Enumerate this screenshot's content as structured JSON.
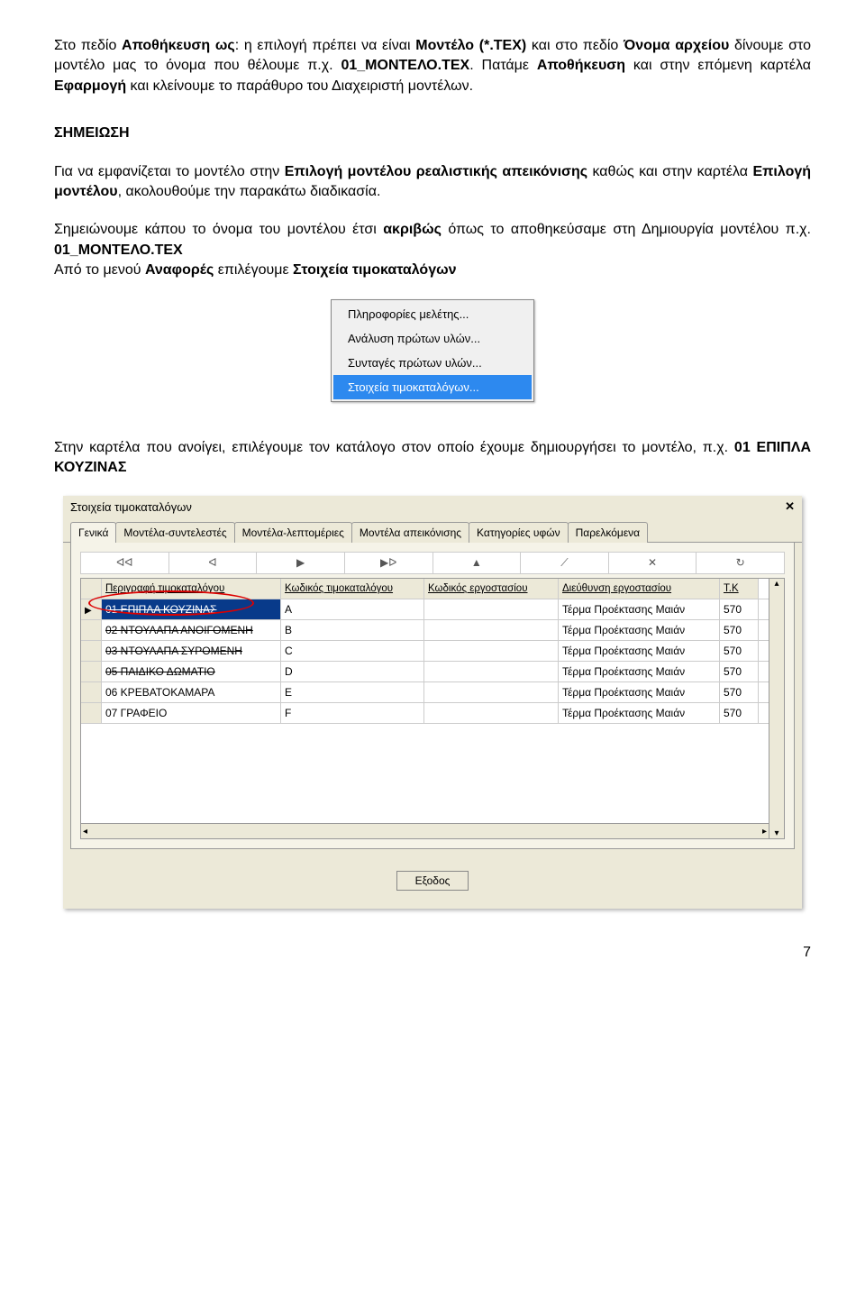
{
  "para1": {
    "t1": "Στο πεδίο ",
    "b1": "Αποθήκευση ως",
    "t2": ": η επιλογή πρέπει να είναι ",
    "b2": "Μοντέλο (*.TEX)",
    "t3": " και στο πεδίο ",
    "b3": "Όνομα αρχείου",
    "t4": " δίνουμε στο μοντέλο μας το όνομα που θέλουμε π.χ. ",
    "b4": "01_ΜΟΝΤΕΛΟ.TEX",
    "t5": ". Πατάμε ",
    "b5": "Αποθήκευση",
    "t6": " και στην επόμενη καρτέλα ",
    "b6": "Εφαρμογή",
    "t7": " και κλείνουμε το παράθυρο του Διαχειριστή μοντέλων."
  },
  "note": {
    "heading": "ΣΗΜΕΙΩΣΗ",
    "t1": "Για να εμφανίζεται το μοντέλο στην ",
    "b1": "Επιλογή μοντέλου ρεαλιστικής απεικόνισης",
    "t2": " καθώς και στην καρτέλα ",
    "b2": "Επιλογή μοντέλου",
    "t3": ", ακολουθούμε την παρακάτω διαδικασία.",
    "t4": "Σημειώνουμε κάπου το όνομα του μοντέλου έτσι ",
    "b3": "ακριβώς",
    "t5": " όπως το αποθηκεύσαμε στη Δημιουργία μοντέλου π.χ. ",
    "b4": "01_ΜΟΝΤΕΛΟ.TEX",
    "t6": "Από το μενού ",
    "b5": "Αναφορές",
    "t7": " επιλέγουμε ",
    "b6": "Στοιχεία τιμοκαταλόγων"
  },
  "menu": {
    "items": [
      "Πληροφορίες μελέτης...",
      "Ανάλυση πρώτων υλών...",
      "Συνταγές πρώτων υλών...",
      "Στοιχεία τιμοκαταλόγων..."
    ]
  },
  "para2": {
    "t1": "Στην καρτέλα που ανοίγει, επιλέγουμε τον κατάλογο στον οποίο έχουμε δημιουργήσει το μοντέλο, π.χ. ",
    "b1": "01 ΕΠΙΠΛΑ ΚΟΥΖΙΝΑΣ"
  },
  "window": {
    "title": "Στοιχεία τιμοκαταλόγων",
    "close": "✕",
    "tabs": [
      "Γενικά",
      "Μοντέλα-συντελεστές",
      "Μοντέλα-λεπτομέριες",
      "Μοντέλα απεικόνισης",
      "Κατηγορίες υφών",
      "Παρελκόμενα"
    ],
    "nav": [
      "ᐊᐊ",
      "ᐊ",
      "▶",
      "▶ᐅ",
      "▲",
      "⟋",
      "✕",
      "↻"
    ],
    "headers": [
      "Περιγραφή τιμοκαταλόγου",
      "Κωδικός τιμοκαταλόγου",
      "Κωδικός εργοστασίου",
      "Διεύθυνση εργοστασίου",
      "Τ.Κ"
    ],
    "rows": [
      {
        "desc": "01 ΕΠΙΠΛΑ ΚΟΥΖΙΝΑΣ",
        "code": "A",
        "factory": "",
        "addr": "Τέρμα Προέκτασης Μαιάν",
        "tk": "570",
        "selected": true,
        "struck": true
      },
      {
        "desc": "02 ΝΤΟΥΛΑΠΑ ΑΝΟΙΓΟΜΕΝΗ",
        "code": "B",
        "factory": "",
        "addr": "Τέρμα Προέκτασης Μαιάν",
        "tk": "570",
        "struck": true
      },
      {
        "desc": "03 ΝΤΟΥΛΑΠΑ ΣΥΡΟΜΕΝΗ",
        "code": "C",
        "factory": "",
        "addr": "Τέρμα Προέκτασης Μαιάν",
        "tk": "570",
        "struck": true
      },
      {
        "desc": "05 ΠΑΙΔΙΚΟ ΔΩΜΑΤΙΟ",
        "code": "D",
        "factory": "",
        "addr": "Τέρμα Προέκτασης Μαιάν",
        "tk": "570",
        "struck": true
      },
      {
        "desc": "06 ΚΡΕΒΑΤΟΚΑΜΑΡΑ",
        "code": "E",
        "factory": "",
        "addr": "Τέρμα Προέκτασης Μαιάν",
        "tk": "570"
      },
      {
        "desc": "07 ΓΡΑΦΕΙΟ",
        "code": "F",
        "factory": "",
        "addr": "Τέρμα Προέκτασης Μαιάν",
        "tk": "570"
      }
    ],
    "exit": "Εξοδος"
  },
  "page_number": "7"
}
